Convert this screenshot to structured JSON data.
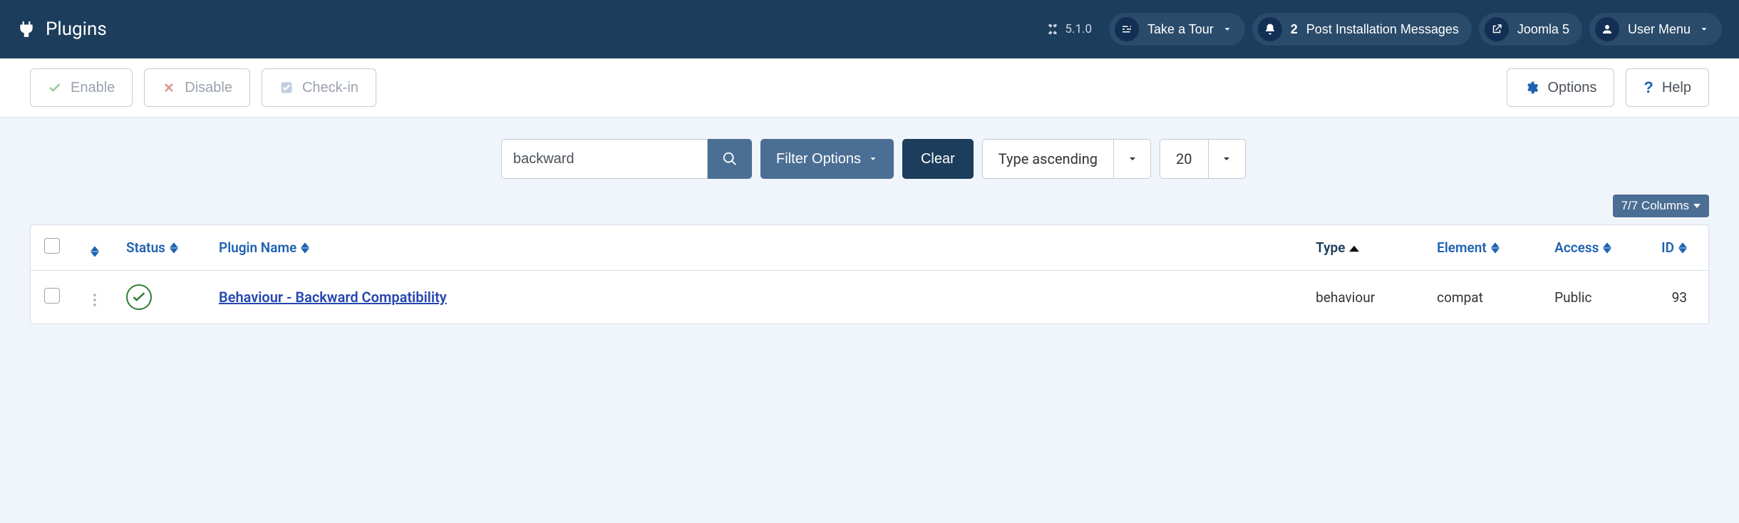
{
  "topbar": {
    "title": "Plugins",
    "version": "5.1.0",
    "tour_label": "Take a Tour",
    "notif_count": "2",
    "post_install_label": "Post Installation Messages",
    "frontend_label": "Joomla 5",
    "user_menu_label": "User Menu"
  },
  "toolbar": {
    "enable": "Enable",
    "disable": "Disable",
    "checkin": "Check-in",
    "options": "Options",
    "help": "Help"
  },
  "filters": {
    "search_value": "backward",
    "filter_options": "Filter Options",
    "clear": "Clear",
    "sort": "Type ascending",
    "limit": "20",
    "columns_label": "7/7 Columns"
  },
  "table": {
    "headers": {
      "status": "Status",
      "plugin_name": "Plugin Name",
      "type": "Type",
      "element": "Element",
      "access": "Access",
      "id": "ID"
    },
    "rows": [
      {
        "name": "Behaviour - Backward Compatibility",
        "type": "behaviour",
        "element": "compat",
        "access": "Public",
        "id": "93"
      }
    ]
  }
}
